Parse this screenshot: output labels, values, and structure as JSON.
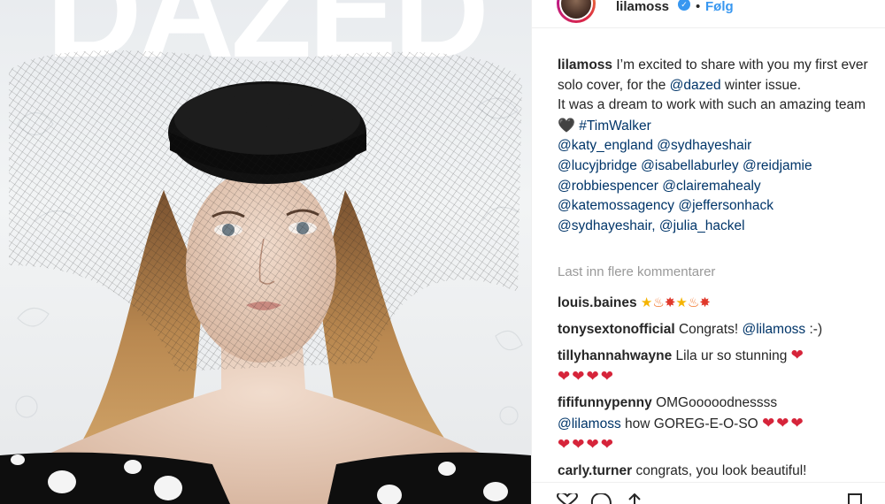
{
  "cover": {
    "masthead": "DAZED"
  },
  "post": {
    "username": "lilamoss",
    "verified_mark": "✓",
    "separator": "•",
    "follow_label": "Følg"
  },
  "caption": {
    "author": "lilamoss",
    "line1": "I’m excited to share with you my first ever solo cover, for the ",
    "mention_dazed": "@dazed",
    "line1_end": " winter issue.",
    "line2": "It was a dream to work with such an amazing team ",
    "emoji_heart": "🖤",
    "tag_timwalker": "#TimWalker",
    "mentions": [
      "@katy_england",
      "@sydhayeshair",
      "@lucyjbridge",
      "@isabellaburley",
      "@reidjamie",
      "@robbiespencer",
      "@clairemahealy",
      "@katemossagency",
      "@jeffersonhack",
      "@sydhayeshair,",
      "@julia_hackel"
    ]
  },
  "load_more_label": "Last inn flere kommentarer",
  "comments": [
    {
      "user": "louis.baines",
      "text": "",
      "emoji": "⭐🔥💥⭐🔥💥"
    },
    {
      "user": "tonysextonofficial",
      "text": "Congrats! ",
      "mention": "@lilamoss",
      "text_end": " :-)"
    },
    {
      "user": "tillyhannahwayne",
      "text": "Lila ur so stunning ",
      "hearts1": "❤",
      "hearts2": "❤❤❤❤"
    },
    {
      "user": "fififunnypenny",
      "text": "OMGooooodnessss ",
      "mention": "@lilamoss",
      "text_end": " how GOREG-E-O-SO ",
      "hearts1": "❤❤❤",
      "hearts2": "❤❤❤❤"
    },
    {
      "user": "carly.turner",
      "text": "congrats, you look beautiful!"
    }
  ],
  "icons": [
    "heart-icon",
    "comment-icon",
    "share-icon",
    "bookmark-icon"
  ],
  "colors": {
    "link": "#003569",
    "username_text": "#262626",
    "muted": "#999999",
    "follow_blue": "#3897f0"
  }
}
